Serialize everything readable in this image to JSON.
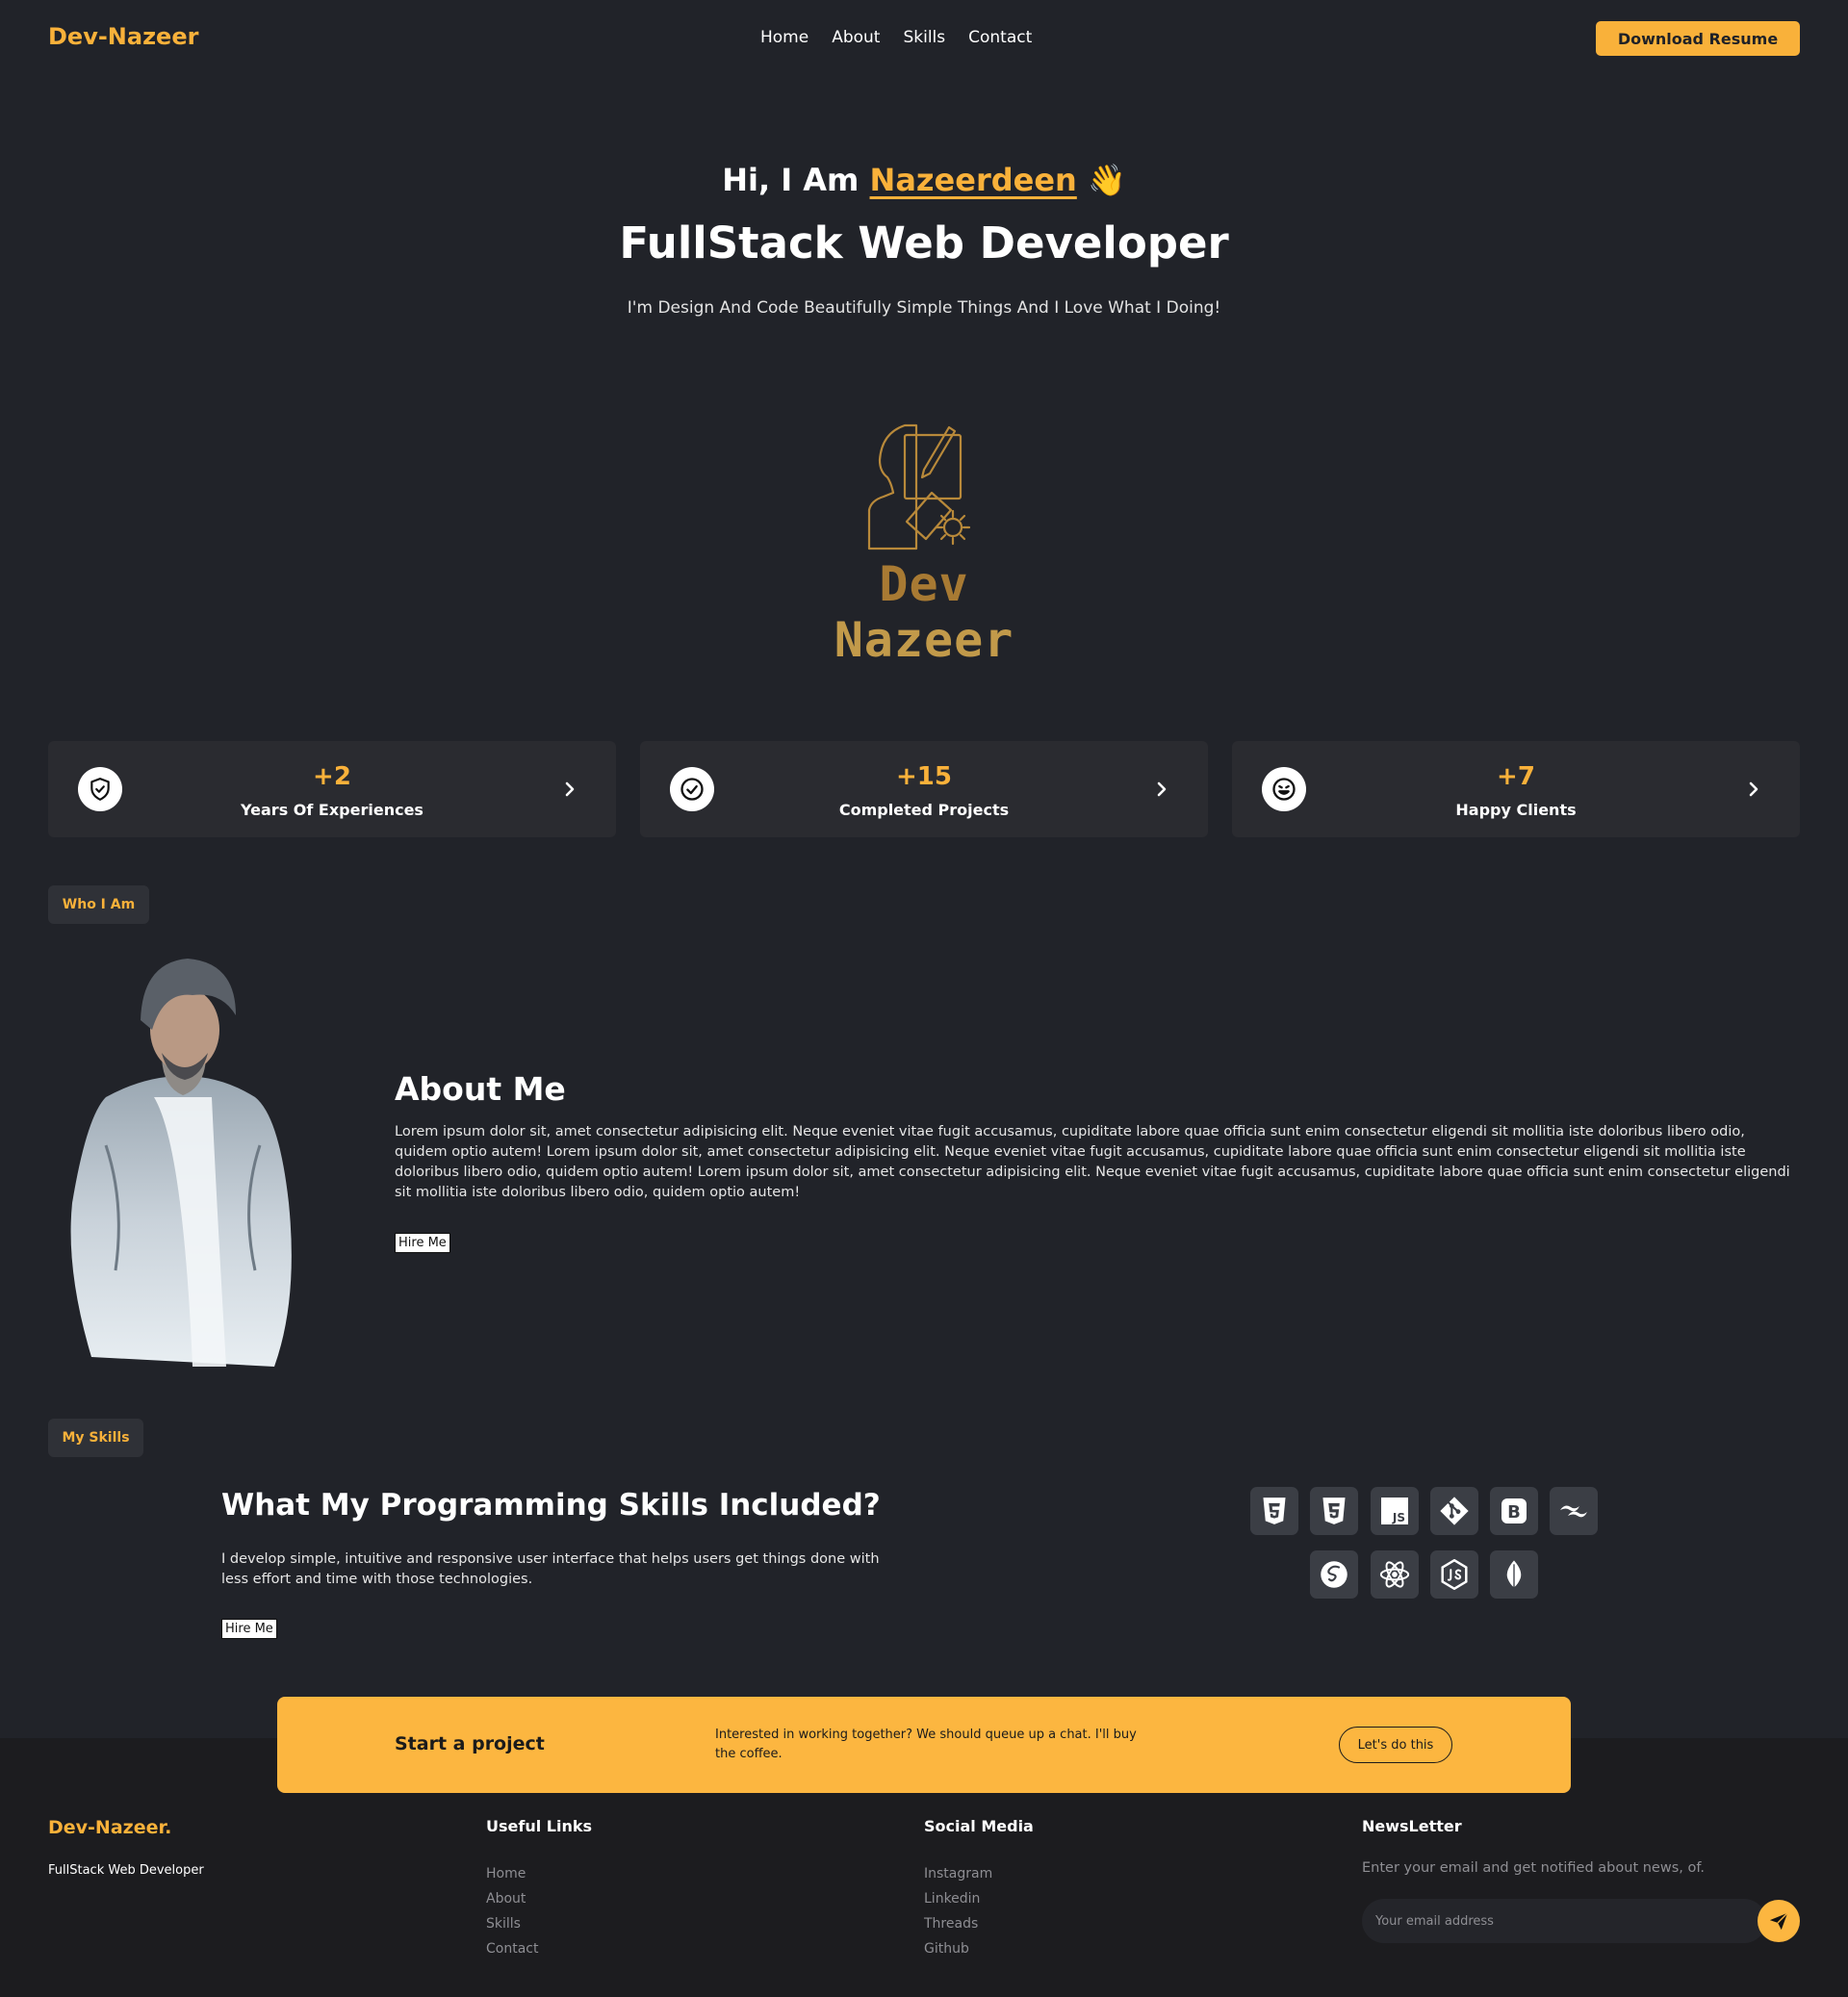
{
  "nav": {
    "brand": "Dev-Nazeer",
    "links": [
      "Home",
      "About",
      "Skills",
      "Contact"
    ],
    "resume_button": "Download Resume"
  },
  "hero": {
    "greeting_prefix": "Hi, I Am",
    "name": "Nazeerdeen",
    "wave_emoji": "👋",
    "title": "FullStack Web Developer",
    "subtitle": "I'm Design And Code Beautifully Simple Things And I Love What I Doing!",
    "logo_text_first": "Dev",
    "logo_text_second": "Nazeer"
  },
  "stats": [
    {
      "icon": "shield-check-icon",
      "value": "+2",
      "label": "Years Of Experiences"
    },
    {
      "icon": "check-circle-icon",
      "value": "+15",
      "label": "Completed Projects"
    },
    {
      "icon": "smile-icon",
      "value": "+7",
      "label": "Happy Clients"
    }
  ],
  "about": {
    "pill": "Who I Am",
    "title": "About Me",
    "text": "Lorem ipsum dolor sit, amet consectetur adipisicing elit. Neque eveniet vitae fugit accusamus, cupiditate labore quae officia sunt enim consectetur eligendi sit mollitia iste doloribus libero odio, quidem optio autem! Lorem ipsum dolor sit, amet consectetur adipisicing elit. Neque eveniet vitae fugit accusamus, cupiditate labore quae officia sunt enim consectetur eligendi sit mollitia iste doloribus libero odio, quidem optio autem! Lorem ipsum dolor sit, amet consectetur adipisicing elit. Neque eveniet vitae fugit accusamus, cupiditate labore quae officia sunt enim consectetur eligendi sit mollitia iste doloribus libero odio, quidem optio autem!",
    "hire_button": "Hire Me"
  },
  "skills": {
    "pill": "My Skills",
    "title": "What My Programming Skills Included?",
    "text": "I develop simple, intuitive and responsive user interface that helps users get things done with less effort and time with those technologies.",
    "hire_button": "Hire Me",
    "icons": [
      "html5-icon",
      "css3-icon",
      "javascript-icon",
      "git-icon",
      "bootstrap-icon",
      "tailwind-icon",
      "sass-icon",
      "react-icon",
      "nodejs-icon",
      "mongodb-icon"
    ],
    "js_label": "JS",
    "bootstrap_label": "B"
  },
  "cta": {
    "title": "Start a project",
    "text": "Interested in working together? We should queue up a chat. I'll buy the coffee.",
    "button": "Let's do this"
  },
  "footer": {
    "brand": "Dev-Nazeer.",
    "tagline": "FullStack Web Developer",
    "useful_title": "Useful Links",
    "useful_links": [
      "Home",
      "About",
      "Skills",
      "Contact"
    ],
    "social_title": "Social Media",
    "social_links": [
      "Instagram",
      "Linkedin",
      "Threads",
      "Github"
    ],
    "newsletter_title": "NewsLetter",
    "newsletter_text": "Enter your email and get notified about news, of.",
    "email_placeholder": "Your email address"
  },
  "colors": {
    "background": "#212329",
    "accent": "#f9b13a",
    "card": "#2a2b30",
    "footer": "#1c1c1f"
  }
}
